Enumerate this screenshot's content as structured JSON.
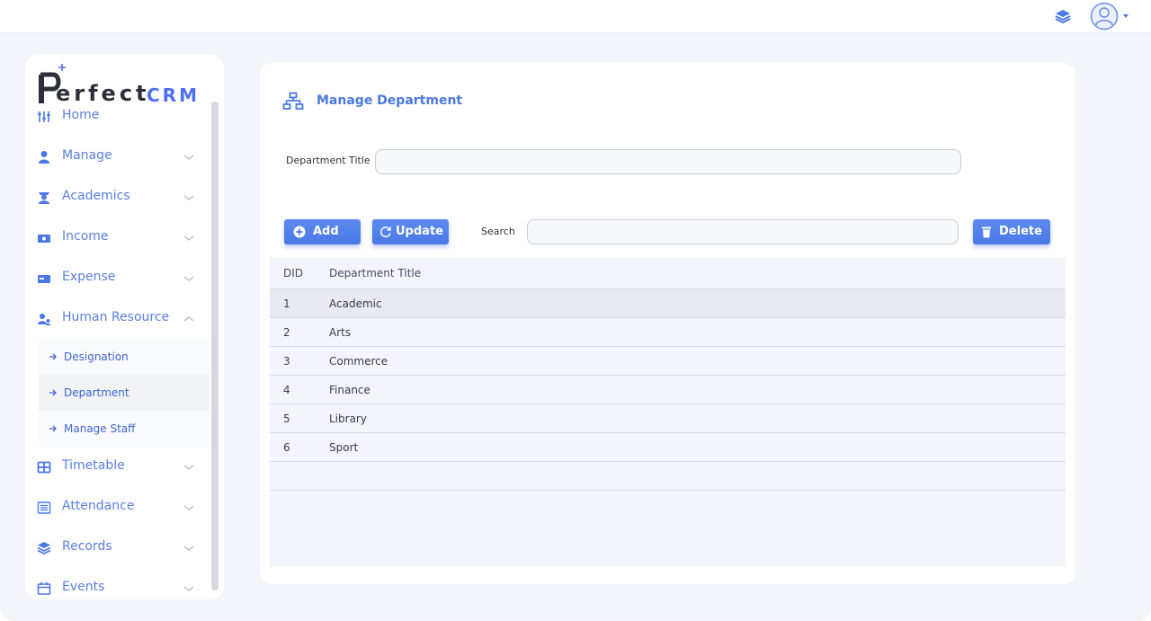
{
  "brand": {
    "word": "erfect",
    "suffix": "CRM",
    "accent": "#4f6ff0"
  },
  "topbar": {
    "icons": [
      "layers-icon",
      "user-avatar-icon",
      "caret-down-icon"
    ]
  },
  "sidebar": {
    "items": [
      {
        "label": "Home",
        "icon": "sliders-icon"
      },
      {
        "label": "Manage",
        "icon": "person-icon"
      },
      {
        "label": "Academics",
        "icon": "graduate-icon"
      },
      {
        "label": "Income",
        "icon": "cash-icon"
      },
      {
        "label": "Expense",
        "icon": "card-icon"
      },
      {
        "label": "Human Resource",
        "icon": "people-icon",
        "expanded": true
      },
      {
        "label": "Timetable",
        "icon": "grid-icon"
      },
      {
        "label": "Attendance",
        "icon": "list-icon"
      },
      {
        "label": "Records",
        "icon": "layers-icon"
      },
      {
        "label": "Events",
        "icon": "calendar-icon"
      }
    ],
    "sub_items": [
      {
        "label": "Designation"
      },
      {
        "label": "Department",
        "active": true
      },
      {
        "label": "Manage Staff"
      }
    ]
  },
  "main": {
    "title": "Manage Department",
    "department_title_label": "Department Title",
    "department_title_value": "",
    "buttons": {
      "add": "Add",
      "update": "Update",
      "delete": "Delete"
    },
    "search_label": "Search",
    "search_value": "",
    "table": {
      "columns": [
        "DID",
        "Department Title"
      ],
      "rows": [
        [
          "1",
          "Academic"
        ],
        [
          "2",
          "Arts"
        ],
        [
          "3",
          "Commerce"
        ],
        [
          "4",
          "Finance"
        ],
        [
          "5",
          "Library"
        ],
        [
          "6",
          "Sport"
        ]
      ]
    }
  }
}
